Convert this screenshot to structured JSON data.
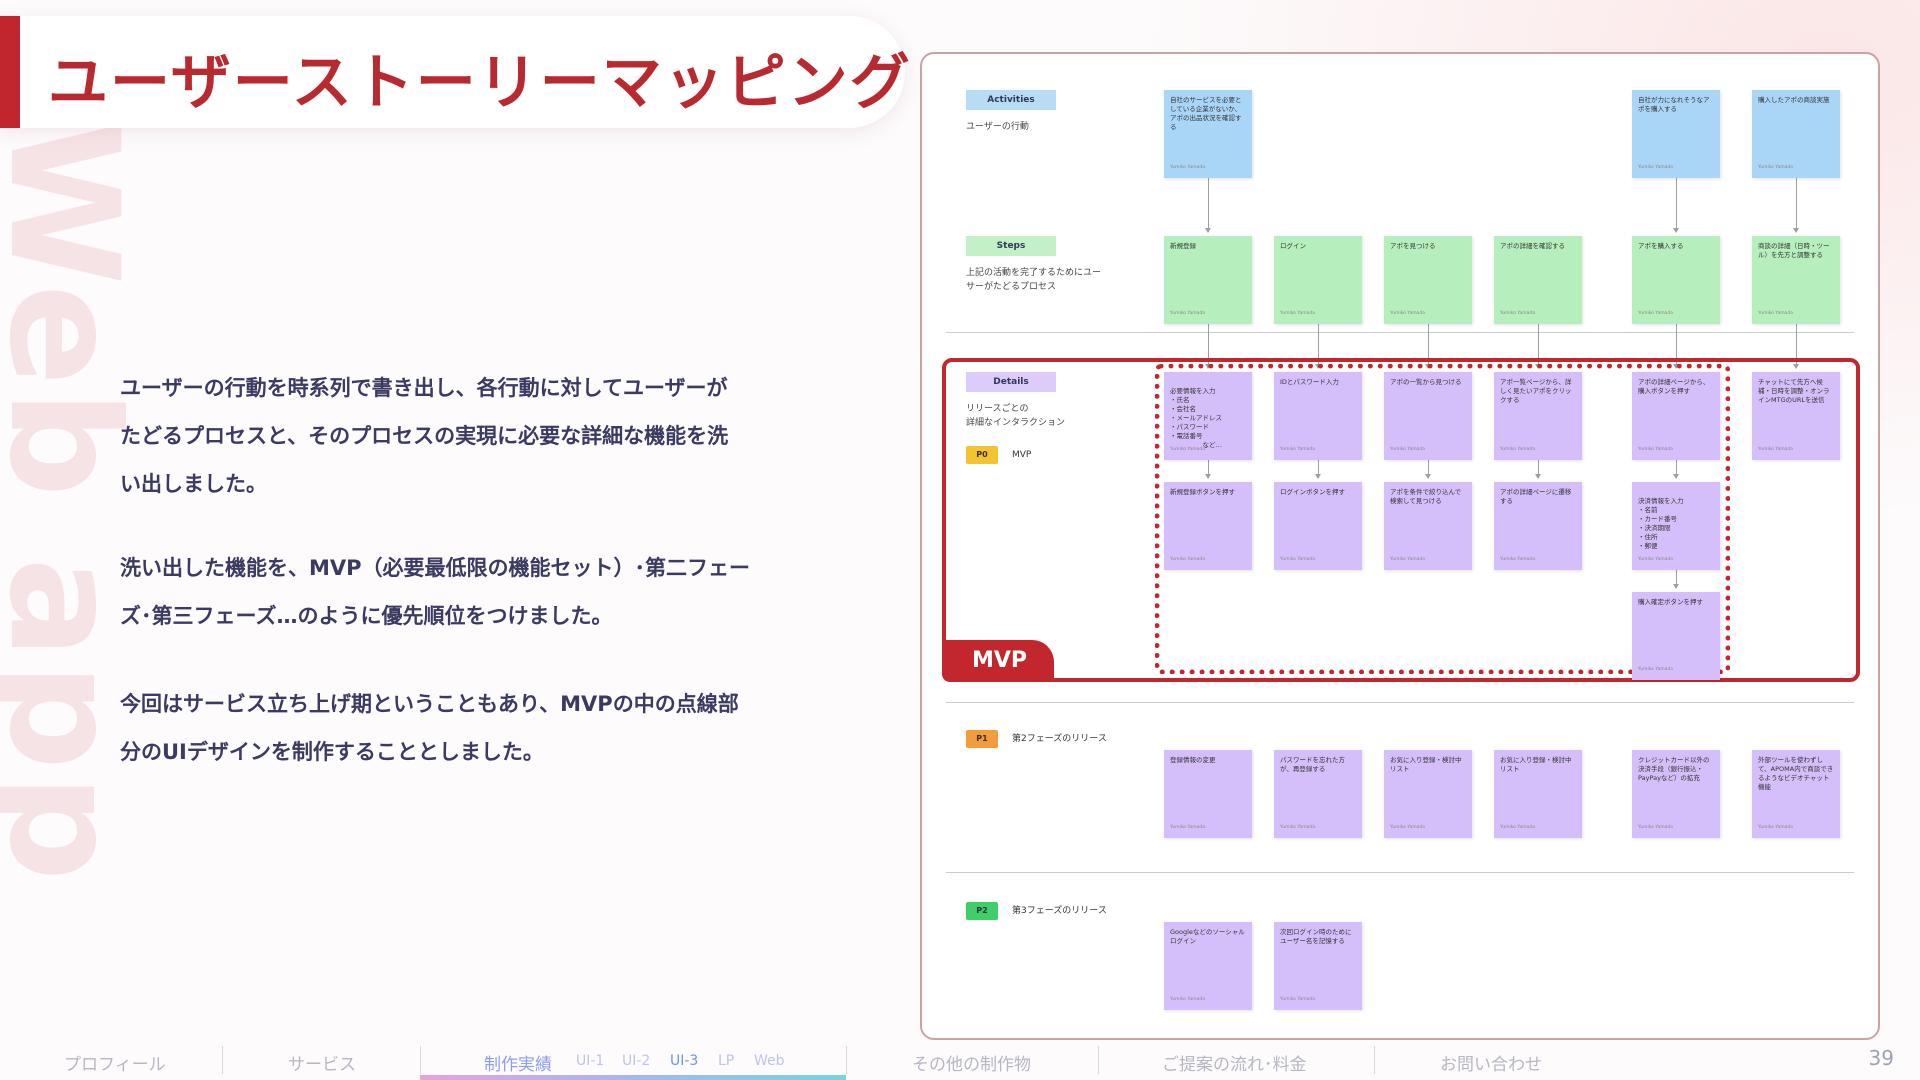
{
  "title": "ユーザーストーリーマッピング",
  "watermark": "Web app",
  "body": {
    "p1_line1": "ユーザーの行動を時系列で書き出し、各行動に対してユーザーが",
    "p1_line2": "たどるプロセスと、そのプロセスの実現に必要な詳細な機能を洗",
    "p1_line3": "い出しました。",
    "p2_line1": "洗い出した機能を、MVP（必要最低限の機能セット）･第二フェー",
    "p2_line2": "ズ･第三フェーズ…のように優先順位をつけました。",
    "p3_line1": "今回はサービス立ち上げ期ということもあり、MVPの中の点線部",
    "p3_line2": "分のUIデザインを制作することとしました。"
  },
  "map": {
    "activities_label": "Activities",
    "activities_desc": "ユーザーの行動",
    "steps_label": "Steps",
    "steps_desc_1": "上記の活動を完了するためにユー",
    "steps_desc_2": "サーがたどるプロセス",
    "details_label": "Details",
    "details_desc_1": "リリースごとの",
    "details_desc_2": "詳細なインタラクション",
    "p0_badge": "P0",
    "p0_label": "MVP",
    "p1_badge": "P1",
    "p1_label": "第2フェーズのリリース",
    "p2_badge": "P2",
    "p2_label": "第3フェーズのリリース",
    "mvp_tag": "MVP",
    "author": "Yumiko Yamada",
    "activities": [
      "自社のサービスを必要としている企業がないか、アポの出品状況を確認する",
      "自社が力になれそうなアポを購入する",
      "購入したアポの商談実施"
    ],
    "steps": [
      "新規登録",
      "ログイン",
      "アポを見つける",
      "アポの詳細を確認する",
      "アポを購入する",
      "商談の詳細（日時・ツール）を先方と調整する"
    ],
    "details_row1": [
      "必要情報を入力\n・氏名\n・会社名\n・メールアドレス\n・パスワード\n・電話番号\n　　　　　など…",
      "IDとパスワード入力",
      "アポの一覧から見つける",
      "アポ一覧ページから、詳しく見たいアポをクリックする",
      "アポの詳細ページから、購入ボタンを押す",
      "チャットにて先方へ候補・日時を調整・オンラインMTGのURLを送信"
    ],
    "details_row2": [
      "新規登録ボタンを押す",
      "ログインボタンを押す",
      "アポを条件で絞り込んで検索して見つける",
      "アポの詳細ページに遷移する",
      "決済情報を入力\n・名前\n・カード番号\n・決済期限\n・住所\n・郵便"
    ],
    "details_row3": "購入確定ボタンを押す",
    "p1_items": [
      "登録情報の変更",
      "パスワードを忘れた方が、再登録する",
      "お気に入り登録・検討中リスト",
      "お気に入り登録・検討中リスト",
      "クレジットカード以外の決済手段（銀行振込・PayPayなど）の拡充",
      "外部ツールを使わずして、APOMA内で商談できるようなビデオチャット機能"
    ],
    "p2_items": [
      "Googleなどのソーシャルログイン",
      "次回ログイン時のためにユーザー名を記憶する"
    ]
  },
  "nav": {
    "items": [
      "プロフィール",
      "サービス",
      "制作実績",
      "その他の制作物",
      "ご提案の流れ･料金",
      "お問い合わせ"
    ],
    "subs": [
      "UI-1",
      "UI-2",
      "UI-3",
      "LP",
      "Web"
    ]
  },
  "page_number": "39",
  "colors": {
    "accent": "#c2272d",
    "activity": "#a9d6f7",
    "step": "#b6efbd",
    "detail": "#d4bffb"
  }
}
